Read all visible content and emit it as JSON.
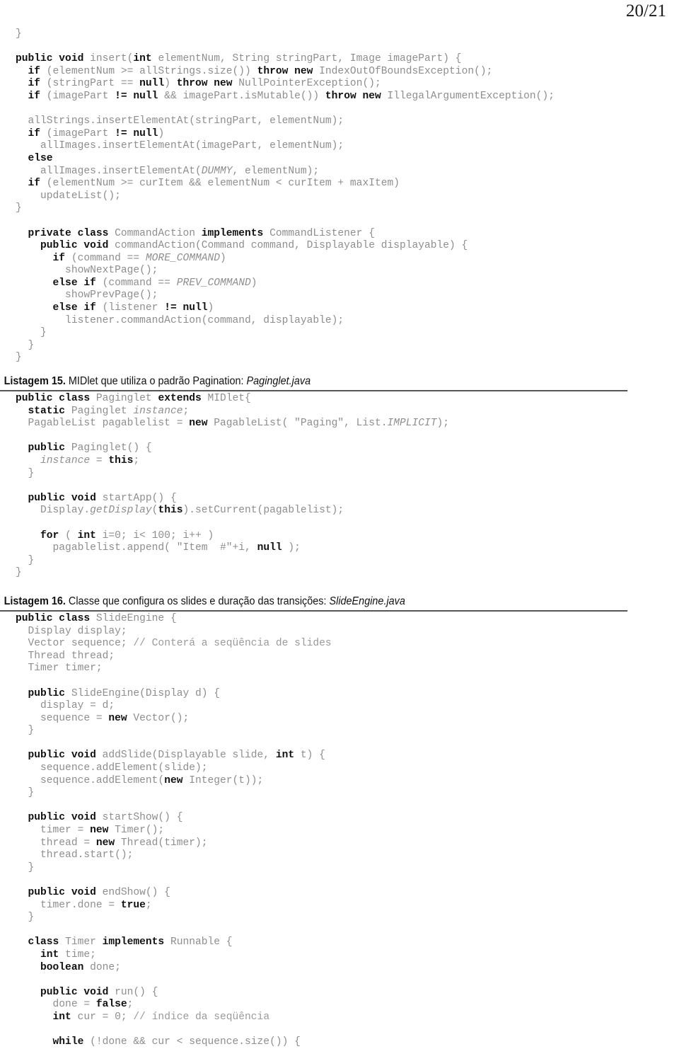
{
  "page": {
    "number_label": "20/21"
  },
  "block1": {
    "name": "pagablelist-insert-code",
    "lines": [
      [
        {
          "t": "}",
          "s": "plain"
        }
      ],
      [
        {
          "t": "",
          "s": "plain"
        }
      ],
      [
        {
          "t": "public void ",
          "s": "bold"
        },
        {
          "t": "insert(",
          "s": "plain"
        },
        {
          "t": "int ",
          "s": "bold"
        },
        {
          "t": "elementNum, String stringPart, Image imagePart) {",
          "s": "plain"
        }
      ],
      [
        {
          "t": "  ",
          "s": "plain"
        },
        {
          "t": "if ",
          "s": "bold"
        },
        {
          "t": "(elementNum >= allStrings.size()) ",
          "s": "plain"
        },
        {
          "t": "throw new ",
          "s": "bold"
        },
        {
          "t": "IndexOutOfBoundsException();",
          "s": "plain"
        }
      ],
      [
        {
          "t": "  ",
          "s": "plain"
        },
        {
          "t": "if ",
          "s": "bold"
        },
        {
          "t": "(stringPart == ",
          "s": "plain"
        },
        {
          "t": "null",
          "s": "bold"
        },
        {
          "t": ") ",
          "s": "plain"
        },
        {
          "t": "throw new ",
          "s": "bold"
        },
        {
          "t": "NullPointerException();",
          "s": "plain"
        }
      ],
      [
        {
          "t": "  ",
          "s": "plain"
        },
        {
          "t": "if ",
          "s": "bold"
        },
        {
          "t": "(imagePart ",
          "s": "plain"
        },
        {
          "t": "!= null",
          "s": "bold"
        },
        {
          "t": " && imagePart.isMutable()) ",
          "s": "plain"
        },
        {
          "t": "throw new ",
          "s": "bold"
        },
        {
          "t": "IllegalArgumentException();",
          "s": "plain"
        }
      ],
      [
        {
          "t": "",
          "s": "plain"
        }
      ],
      [
        {
          "t": "  allStrings.insertElementAt(stringPart, elementNum);",
          "s": "plain"
        }
      ],
      [
        {
          "t": "  ",
          "s": "plain"
        },
        {
          "t": "if ",
          "s": "bold"
        },
        {
          "t": "(imagePart ",
          "s": "plain"
        },
        {
          "t": "!= null",
          "s": "bold"
        },
        {
          "t": ")",
          "s": "plain"
        }
      ],
      [
        {
          "t": "    allImages.insertElementAt(imagePart, elementNum);",
          "s": "plain"
        }
      ],
      [
        {
          "t": "  ",
          "s": "plain"
        },
        {
          "t": "else",
          "s": "bold"
        }
      ],
      [
        {
          "t": "    allImages.insertElementAt(",
          "s": "plain"
        },
        {
          "t": "DUMMY",
          "s": "ital"
        },
        {
          "t": ", elementNum);",
          "s": "plain"
        }
      ],
      [
        {
          "t": "  ",
          "s": "plain"
        },
        {
          "t": "if ",
          "s": "bold"
        },
        {
          "t": "(elementNum >= curItem && elementNum < curItem + maxItem)",
          "s": "plain"
        }
      ],
      [
        {
          "t": "    updateList();",
          "s": "plain"
        }
      ],
      [
        {
          "t": "}",
          "s": "plain"
        }
      ],
      [
        {
          "t": "",
          "s": "plain"
        }
      ],
      [
        {
          "t": "  ",
          "s": "plain"
        },
        {
          "t": "private class ",
          "s": "bold"
        },
        {
          "t": "CommandAction ",
          "s": "plain"
        },
        {
          "t": "implements ",
          "s": "bold"
        },
        {
          "t": "CommandListener {",
          "s": "plain"
        }
      ],
      [
        {
          "t": "    ",
          "s": "plain"
        },
        {
          "t": "public void ",
          "s": "bold"
        },
        {
          "t": "commandAction(Command command, Displayable displayable) {",
          "s": "plain"
        }
      ],
      [
        {
          "t": "      ",
          "s": "plain"
        },
        {
          "t": "if ",
          "s": "bold"
        },
        {
          "t": "(command == ",
          "s": "plain"
        },
        {
          "t": "MORE_COMMAND",
          "s": "ital"
        },
        {
          "t": ")",
          "s": "plain"
        }
      ],
      [
        {
          "t": "        showNextPage();",
          "s": "plain"
        }
      ],
      [
        {
          "t": "      ",
          "s": "plain"
        },
        {
          "t": "else if ",
          "s": "bold"
        },
        {
          "t": "(command == ",
          "s": "plain"
        },
        {
          "t": "PREV_COMMAND",
          "s": "ital"
        },
        {
          "t": ")",
          "s": "plain"
        }
      ],
      [
        {
          "t": "        showPrevPage();",
          "s": "plain"
        }
      ],
      [
        {
          "t": "      ",
          "s": "plain"
        },
        {
          "t": "else if ",
          "s": "bold"
        },
        {
          "t": "(listener ",
          "s": "plain"
        },
        {
          "t": "!= null",
          "s": "bold"
        },
        {
          "t": ")",
          "s": "plain"
        }
      ],
      [
        {
          "t": "        listener.commandAction(command, displayable);",
          "s": "plain"
        }
      ],
      [
        {
          "t": "    }",
          "s": "plain"
        }
      ],
      [
        {
          "t": "  }",
          "s": "plain"
        }
      ],
      [
        {
          "t": "}",
          "s": "plain"
        }
      ]
    ]
  },
  "listing15": {
    "label": "Listagem 15.",
    "text": " MIDlet que utiliza o padrão Pagination: ",
    "file": "Paginglet.java",
    "lines": [
      [
        {
          "t": "public class ",
          "s": "bold"
        },
        {
          "t": "Paginglet ",
          "s": "plain"
        },
        {
          "t": "extends ",
          "s": "bold"
        },
        {
          "t": "MIDlet{",
          "s": "plain"
        }
      ],
      [
        {
          "t": "  ",
          "s": "plain"
        },
        {
          "t": "static ",
          "s": "bold"
        },
        {
          "t": "Paginglet ",
          "s": "plain"
        },
        {
          "t": "instance",
          "s": "ital"
        },
        {
          "t": ";",
          "s": "plain"
        }
      ],
      [
        {
          "t": "  PagableList pagablelist = ",
          "s": "plain"
        },
        {
          "t": "new ",
          "s": "bold"
        },
        {
          "t": "PagableList( \"Paging\", List.",
          "s": "plain"
        },
        {
          "t": "IMPLICIT",
          "s": "ital"
        },
        {
          "t": ");",
          "s": "plain"
        }
      ],
      [
        {
          "t": "",
          "s": "plain"
        }
      ],
      [
        {
          "t": "  ",
          "s": "plain"
        },
        {
          "t": "public ",
          "s": "bold"
        },
        {
          "t": "Paginglet() {",
          "s": "plain"
        }
      ],
      [
        {
          "t": "    ",
          "s": "plain"
        },
        {
          "t": "instance",
          "s": "ital"
        },
        {
          "t": " = ",
          "s": "plain"
        },
        {
          "t": "this",
          "s": "bold"
        },
        {
          "t": ";",
          "s": "plain"
        }
      ],
      [
        {
          "t": "  }",
          "s": "plain"
        }
      ],
      [
        {
          "t": "",
          "s": "plain"
        }
      ],
      [
        {
          "t": "  ",
          "s": "plain"
        },
        {
          "t": "public void ",
          "s": "bold"
        },
        {
          "t": "startApp() {",
          "s": "plain"
        }
      ],
      [
        {
          "t": "    Display.",
          "s": "plain"
        },
        {
          "t": "getDisplay",
          "s": "ital"
        },
        {
          "t": "(",
          "s": "plain"
        },
        {
          "t": "this",
          "s": "bold"
        },
        {
          "t": ").setCurrent(pagablelist);",
          "s": "plain"
        }
      ],
      [
        {
          "t": "",
          "s": "plain"
        }
      ],
      [
        {
          "t": "    ",
          "s": "plain"
        },
        {
          "t": "for ",
          "s": "bold"
        },
        {
          "t": "( ",
          "s": "plain"
        },
        {
          "t": "int ",
          "s": "bold"
        },
        {
          "t": "i=0; i< 100; i++ )",
          "s": "plain"
        }
      ],
      [
        {
          "t": "      pagablelist.append( \"Item  #\"+i, ",
          "s": "plain"
        },
        {
          "t": "null",
          "s": "bold"
        },
        {
          "t": " );",
          "s": "plain"
        }
      ],
      [
        {
          "t": "  }",
          "s": "plain"
        }
      ],
      [
        {
          "t": "}",
          "s": "plain"
        }
      ]
    ]
  },
  "listing16": {
    "label": "Listagem 16.",
    "text": " Classe que configura os slides e duração das transições: ",
    "file": "SlideEngine.java",
    "lines": [
      [
        {
          "t": "public class ",
          "s": "bold"
        },
        {
          "t": "SlideEngine {",
          "s": "plain"
        }
      ],
      [
        {
          "t": "  Display display;",
          "s": "plain"
        }
      ],
      [
        {
          "t": "  Vector sequence; ",
          "s": "plain"
        },
        {
          "t": "// Conterá a seqüência de slides",
          "s": "comment"
        }
      ],
      [
        {
          "t": "  Thread thread;",
          "s": "plain"
        }
      ],
      [
        {
          "t": "  Timer timer;",
          "s": "plain"
        }
      ],
      [
        {
          "t": "",
          "s": "plain"
        }
      ],
      [
        {
          "t": "  ",
          "s": "plain"
        },
        {
          "t": "public ",
          "s": "bold"
        },
        {
          "t": "SlideEngine(Display d) {",
          "s": "plain"
        }
      ],
      [
        {
          "t": "    display = d;",
          "s": "plain"
        }
      ],
      [
        {
          "t": "    sequence = ",
          "s": "plain"
        },
        {
          "t": "new ",
          "s": "bold"
        },
        {
          "t": "Vector();",
          "s": "plain"
        }
      ],
      [
        {
          "t": "  }",
          "s": "plain"
        }
      ],
      [
        {
          "t": "",
          "s": "plain"
        }
      ],
      [
        {
          "t": "  ",
          "s": "plain"
        },
        {
          "t": "public void ",
          "s": "bold"
        },
        {
          "t": "addSlide(Displayable slide, ",
          "s": "plain"
        },
        {
          "t": "int ",
          "s": "bold"
        },
        {
          "t": "t) {",
          "s": "plain"
        }
      ],
      [
        {
          "t": "    sequence.addElement(slide);",
          "s": "plain"
        }
      ],
      [
        {
          "t": "    sequence.addElement(",
          "s": "plain"
        },
        {
          "t": "new ",
          "s": "bold"
        },
        {
          "t": "Integer(t));",
          "s": "plain"
        }
      ],
      [
        {
          "t": "  }",
          "s": "plain"
        }
      ],
      [
        {
          "t": "",
          "s": "plain"
        }
      ],
      [
        {
          "t": "  ",
          "s": "plain"
        },
        {
          "t": "public void ",
          "s": "bold"
        },
        {
          "t": "startShow() {",
          "s": "plain"
        }
      ],
      [
        {
          "t": "    timer = ",
          "s": "plain"
        },
        {
          "t": "new ",
          "s": "bold"
        },
        {
          "t": "Timer();",
          "s": "plain"
        }
      ],
      [
        {
          "t": "    thread = ",
          "s": "plain"
        },
        {
          "t": "new ",
          "s": "bold"
        },
        {
          "t": "Thread(timer);",
          "s": "plain"
        }
      ],
      [
        {
          "t": "    thread.start();",
          "s": "plain"
        }
      ],
      [
        {
          "t": "  }",
          "s": "plain"
        }
      ],
      [
        {
          "t": "",
          "s": "plain"
        }
      ],
      [
        {
          "t": "  ",
          "s": "plain"
        },
        {
          "t": "public void ",
          "s": "bold"
        },
        {
          "t": "endShow() {",
          "s": "plain"
        }
      ],
      [
        {
          "t": "    timer.done = ",
          "s": "plain"
        },
        {
          "t": "true",
          "s": "bold"
        },
        {
          "t": ";",
          "s": "plain"
        }
      ],
      [
        {
          "t": "  }",
          "s": "plain"
        }
      ],
      [
        {
          "t": "",
          "s": "plain"
        }
      ],
      [
        {
          "t": "  ",
          "s": "plain"
        },
        {
          "t": "class ",
          "s": "bold"
        },
        {
          "t": "Timer ",
          "s": "plain"
        },
        {
          "t": "implements ",
          "s": "bold"
        },
        {
          "t": "Runnable {",
          "s": "plain"
        }
      ],
      [
        {
          "t": "    ",
          "s": "plain"
        },
        {
          "t": "int ",
          "s": "bold"
        },
        {
          "t": "time;",
          "s": "plain"
        }
      ],
      [
        {
          "t": "    ",
          "s": "plain"
        },
        {
          "t": "boolean ",
          "s": "bold"
        },
        {
          "t": "done;",
          "s": "plain"
        }
      ],
      [
        {
          "t": "",
          "s": "plain"
        }
      ],
      [
        {
          "t": "    ",
          "s": "plain"
        },
        {
          "t": "public void ",
          "s": "bold"
        },
        {
          "t": "run() {",
          "s": "plain"
        }
      ],
      [
        {
          "t": "      done = ",
          "s": "plain"
        },
        {
          "t": "false",
          "s": "bold"
        },
        {
          "t": ";",
          "s": "plain"
        }
      ],
      [
        {
          "t": "      ",
          "s": "plain"
        },
        {
          "t": "int ",
          "s": "bold"
        },
        {
          "t": "cur = 0; ",
          "s": "plain"
        },
        {
          "t": "// índice da seqüência",
          "s": "comment"
        }
      ],
      [
        {
          "t": "",
          "s": "plain"
        }
      ],
      [
        {
          "t": "      ",
          "s": "plain"
        },
        {
          "t": "while ",
          "s": "bold"
        },
        {
          "t": "(!done && cur < sequence.size()) {",
          "s": "plain"
        }
      ]
    ]
  }
}
